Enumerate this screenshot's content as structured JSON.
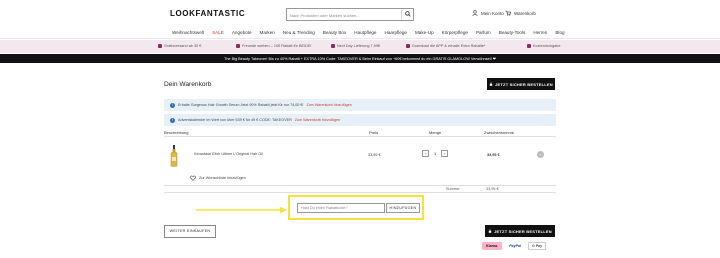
{
  "header": {
    "logo": "LOOKFANTASTIC",
    "search_placeholder": "Nach Produkten oder Marken suchen...",
    "account_label": "Mein Konto",
    "cart_label": "Warenkorb"
  },
  "nav": {
    "items": [
      "Weihnachtswelt",
      "SALE",
      "Angebote",
      "Marken",
      "Neu & Trending",
      "Beauty Box",
      "Hautpflege",
      "Haarpflege",
      "Make-Up",
      "Körperpflege",
      "Parfum",
      "Beauty-Tools",
      "Herren",
      "Blog"
    ]
  },
  "benefits": [
    "Gratisversand ab 30 €",
    "Freunde werben – 10€ Rabatt für BEIDE!",
    "Next Day Lieferung 7,99€",
    "Download die APP & erhalte Extra Rabatte*",
    "Kostenrückgabe"
  ],
  "promo_banner": "The Big Beauty Takeover! Bis zu 40% Rabatt + EXTRA 10% Code: TAKEOVER & Beim Einkauf von +60€ bekommst du ein GRATIS GLAMGLOW Verwöhnset! ❤",
  "cart": {
    "title": "Dein Warenkorb",
    "checkout_label": "JETZT SICHER BESTELLEN",
    "info1_text": "Erhalte Gorgeous Hair Growth Serum Jetzt 90% Rabatt! jetzt für nur 74,00 €!",
    "info1_link": "Zum Warenkorb hinzufügen",
    "info2_text": "Adventskalender im Wert von über 539 € für 49 € CODE: TAKEOVER",
    "info2_link": "Zum Warenkorb hinzufügen",
    "columns": {
      "description": "Beschreibung",
      "price": "Preis",
      "quantity": "Menge",
      "subtotal": "Zwischensumme"
    },
    "item": {
      "name": "Kérastase Elixir Ultime L'Original Hair Oil",
      "price": "33,95 €",
      "quantity": "1",
      "subtotal": "33,95 €",
      "minus": "−",
      "plus": "+",
      "remove": "×"
    },
    "wishlist_label": "Zur Wunschliste hinzufügen",
    "sum_label": "Summe:",
    "sum_value": "33,95 €",
    "promo_placeholder": "Hast Du einen Rabattcode?",
    "promo_button": "HINZUFÜGEN",
    "continue_label": "WEITER EINKAUFEN",
    "payments": [
      "Klarna.",
      "PayPal",
      "G Pay"
    ]
  },
  "colors": {
    "highlight": "#f5e13a",
    "info_bg": "#e8f0f7",
    "benefit_bg": "#f3e8ee",
    "link_red": "#c0392b"
  }
}
